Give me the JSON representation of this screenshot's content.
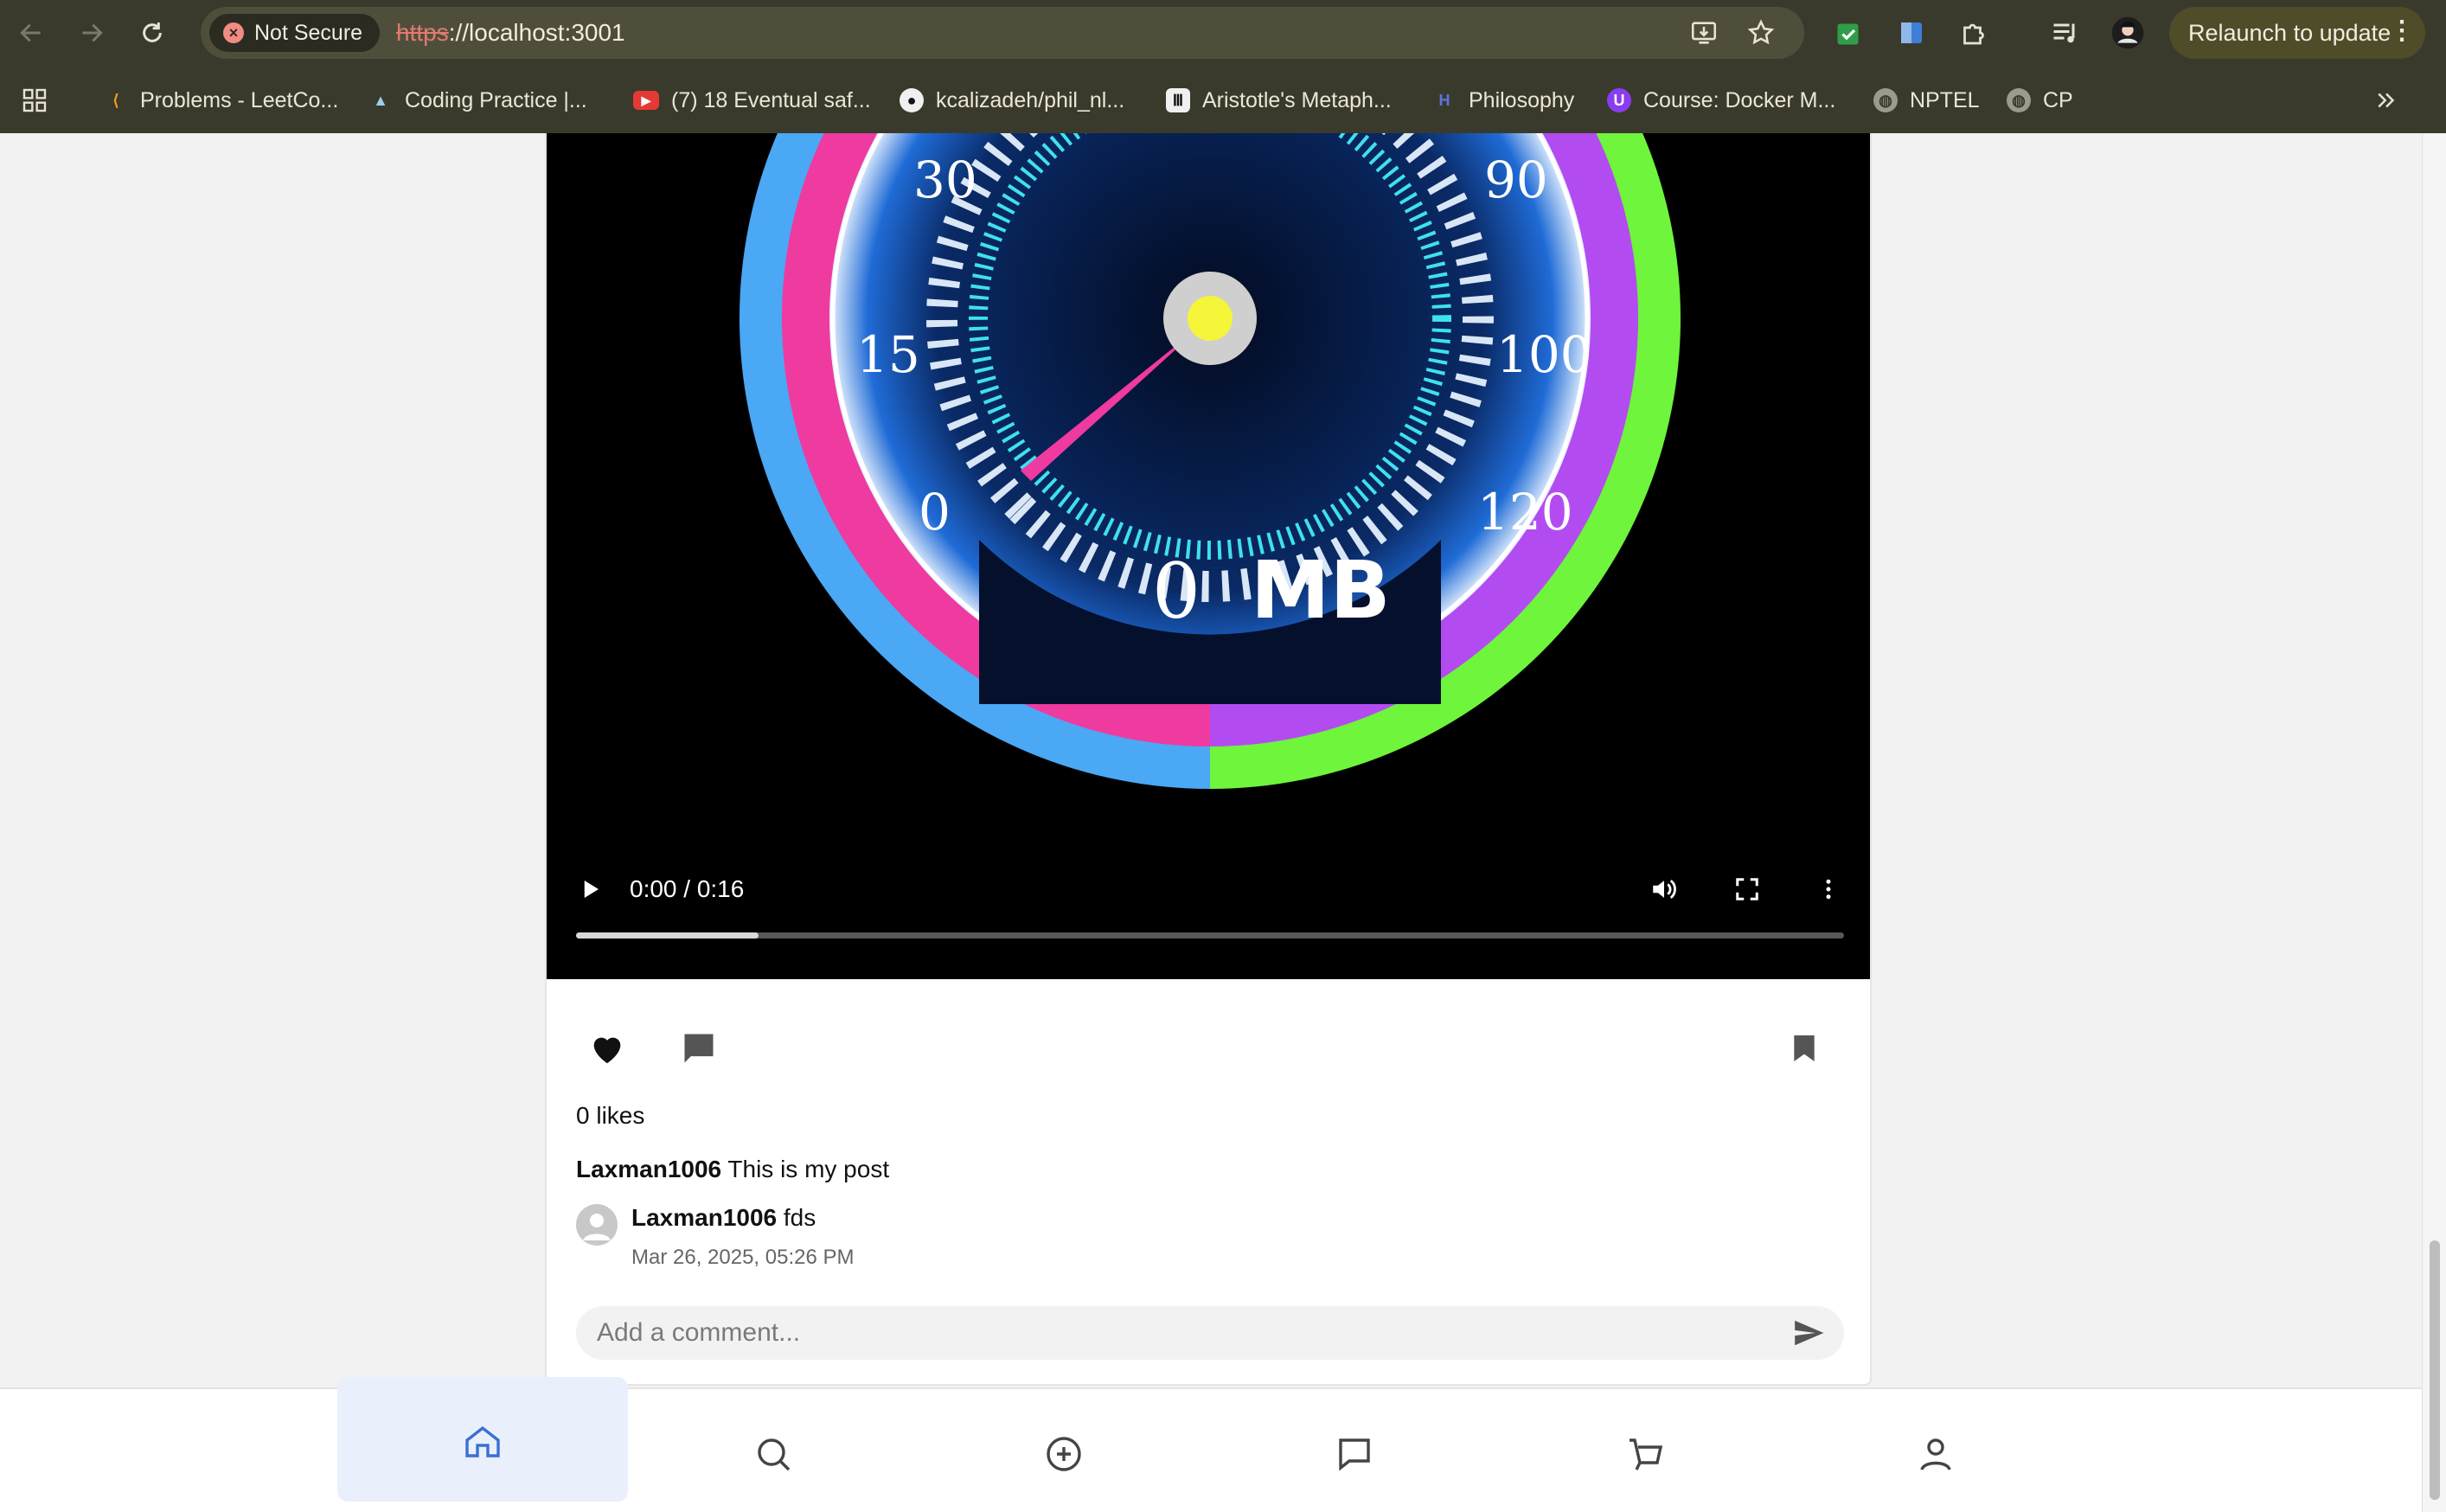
{
  "browser": {
    "security_chip": "Not Secure",
    "url_scheme": "https",
    "url_rest": "://localhost:3001",
    "relaunch_label": "Relaunch to update",
    "bookmarks": [
      {
        "label": "Problems - LeetCo...",
        "icon": "leetcode-icon"
      },
      {
        "label": "Coding Practice |...",
        "icon": "mountain-icon"
      },
      {
        "label": "(7) 18 Eventual saf...",
        "icon": "youtube-icon"
      },
      {
        "label": "kcalizadeh/phil_nl...",
        "icon": "github-icon"
      },
      {
        "label": "Aristotle's Metaph...",
        "icon": "library-icon"
      },
      {
        "label": "Philosophy",
        "icon": "h-icon"
      },
      {
        "label": "Course: Docker M...",
        "icon": "course-icon"
      },
      {
        "label": "NPTEL",
        "icon": "globe-icon"
      },
      {
        "label": "CP",
        "icon": "globe-icon"
      }
    ]
  },
  "video": {
    "time_display": "0:00 / 0:16",
    "progress_fraction": 0.144,
    "speedometer": {
      "left_ticks": [
        "30",
        "15",
        "0"
      ],
      "right_ticks": [
        "90",
        "100",
        "120"
      ],
      "readout_value": "0",
      "readout_unit": "MB"
    }
  },
  "post": {
    "likes_text": "0 likes",
    "author": "Laxman1006",
    "caption": "This is my post",
    "comments": [
      {
        "author": "Laxman1006",
        "text": "fds",
        "date": "Mar 26, 2025, 05:26 PM"
      }
    ],
    "add_comment_placeholder": "Add a comment..."
  },
  "colors": {
    "accent_blue": "#3b6fd4",
    "like_heart": "#111111",
    "gauge_blue": "#4aa8f5",
    "gauge_pink": "#ef3aa0",
    "gauge_purple": "#b34cf0",
    "gauge_green": "#6ef53c"
  },
  "bottom_nav": {
    "items": [
      "home-icon",
      "search-icon",
      "add-circle-icon",
      "message-icon",
      "shop-icon",
      "profile-icon"
    ],
    "active": "home-icon"
  }
}
